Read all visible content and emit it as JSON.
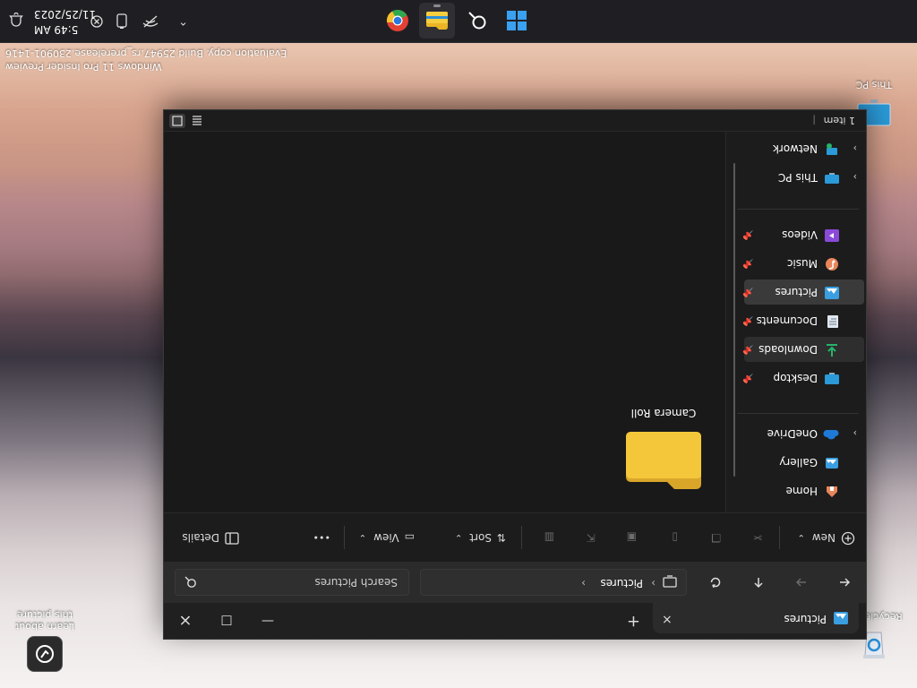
{
  "desktop": {
    "icons": [
      {
        "label": "Recycle Bin",
        "icon": "recycle-bin-icon"
      },
      {
        "label": "This PC",
        "icon": "computer-icon"
      },
      {
        "label": "Learn about this picture",
        "icon": "camera-icon"
      }
    ],
    "watermark": {
      "line1": "Windows 11 Pro Insider Preview",
      "line2": "Evaluation copy. Build 25947.rs_prerelease.230901-1416"
    }
  },
  "taskbar": {
    "apps": [
      {
        "name": "Start",
        "icon": "windows-start-icon"
      },
      {
        "name": "Search",
        "icon": "search-icon"
      },
      {
        "name": "File Explorer",
        "icon": "file-explorer-icon",
        "active": true
      },
      {
        "name": "Google Chrome",
        "icon": "chrome-icon"
      }
    ],
    "tray": {
      "chevron": "show-hidden-icons",
      "icons": [
        "network-icon",
        "battery-icon",
        "notification-icon"
      ]
    },
    "clock": {
      "time": "5:49 AM",
      "date": "11/25/2023"
    }
  },
  "explorer": {
    "tab": {
      "label": "Pictures",
      "close": "×"
    },
    "new_tab": "+",
    "window_controls": {
      "minimize": "—",
      "maximize": "□",
      "close": "×"
    },
    "address": {
      "segments": [
        "Pictures"
      ]
    },
    "search": {
      "placeholder": "Search Pictures"
    },
    "commands": {
      "new": "New",
      "sort": "Sort",
      "view": "View",
      "more": "•••",
      "details": "Details"
    },
    "nav": {
      "quick": [
        {
          "label": "Home",
          "icon": "home-icon"
        },
        {
          "label": "Gallery",
          "icon": "gallery-icon"
        },
        {
          "label": "OneDrive",
          "icon": "onedrive-icon",
          "expand": true
        }
      ],
      "pinned": [
        {
          "label": "Desktop",
          "icon": "desktop-folder-icon"
        },
        {
          "label": "Downloads",
          "icon": "downloads-folder-icon"
        },
        {
          "label": "Documents",
          "icon": "documents-folder-icon"
        },
        {
          "label": "Pictures",
          "icon": "pictures-folder-icon",
          "selected": true
        },
        {
          "label": "Music",
          "icon": "music-folder-icon"
        },
        {
          "label": "Videos",
          "icon": "videos-folder-icon"
        }
      ],
      "devices": [
        {
          "label": "This PC",
          "icon": "this-pc-icon",
          "expand": true
        },
        {
          "label": "Network",
          "icon": "network-icon",
          "expand": true
        }
      ]
    },
    "items": [
      {
        "name": "Camera Roll",
        "type": "folder"
      }
    ],
    "status": {
      "count": "1 item"
    }
  },
  "colors": {
    "window_bg": "#1c1c1c",
    "folder_yellow": "#f4c73b",
    "accent_blue": "#0f6cbd"
  }
}
